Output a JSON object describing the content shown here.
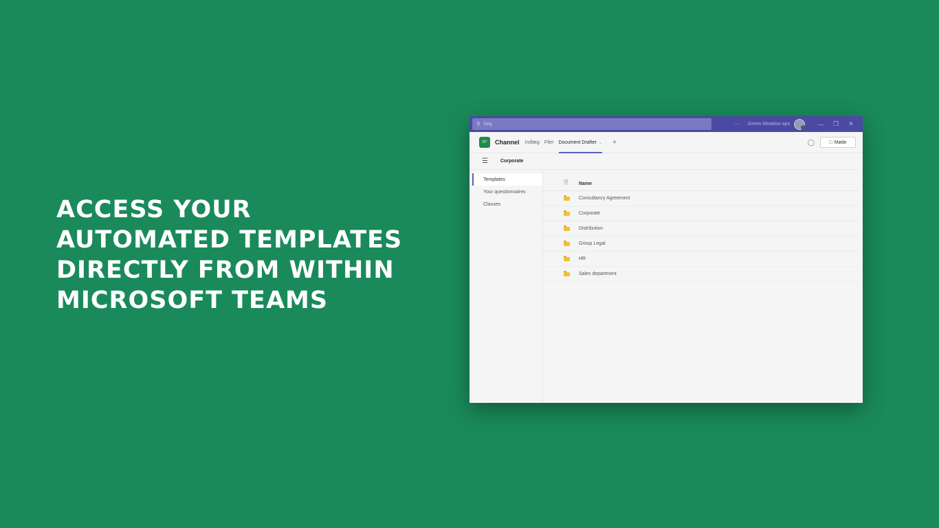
{
  "headline": {
    "lines": [
      "ACCESS YOUR",
      "AUTOMATED TEMPLATES",
      "DIRECTLY FROM WITHIN",
      "MICROSOFT TEAMS"
    ]
  },
  "titlebar": {
    "search_placeholder": "Søg",
    "more": "···",
    "org_name": "Green Meadow aps",
    "minimize": "—",
    "restore": "❐",
    "close": "✕"
  },
  "tabbar": {
    "badge": "DT",
    "channel": "Channel",
    "tabs": [
      {
        "label": "Indlæg"
      },
      {
        "label": "Filer"
      },
      {
        "label": "Document Drafter"
      }
    ],
    "chevron": "⌄",
    "add": "+",
    "meet_label": "Møde"
  },
  "crumbbar": {
    "title": "Corporate"
  },
  "sidebar": {
    "items": [
      {
        "label": "Templates"
      },
      {
        "label": "Your questionnaires"
      },
      {
        "label": "Clauses"
      }
    ]
  },
  "table": {
    "header_name": "Name",
    "rows": [
      {
        "name": "Consultancy Agreement"
      },
      {
        "name": "Corporate"
      },
      {
        "name": "Distribution"
      },
      {
        "name": "Group Legal"
      },
      {
        "name": "HR"
      },
      {
        "name": "Sales department"
      }
    ]
  },
  "colors": {
    "background": "#1a8a5a",
    "titlebar": "#4a4aa3",
    "accent": "#5b5fc7",
    "folder": "#f2c037"
  },
  "icons": {
    "search": "search-icon",
    "chat": "chat-icon",
    "camera": "video-camera-icon",
    "hamburger": "hamburger-menu-icon",
    "file": "file-icon",
    "folder": "folder-icon"
  }
}
